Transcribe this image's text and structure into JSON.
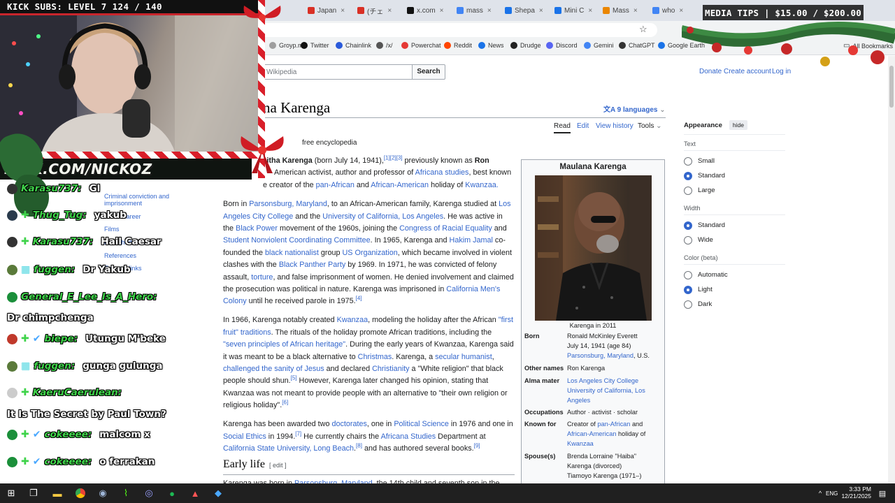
{
  "browser": {
    "tabs": [
      {
        "label": "Japan",
        "color": "#d93025"
      },
      {
        "label": "(チェ",
        "color": "#d93025"
      },
      {
        "label": "x.com",
        "color": "#111111"
      },
      {
        "label": "mass",
        "color": "#4285f4"
      },
      {
        "label": "Shepa",
        "color": "#1a73e8"
      },
      {
        "label": "Mini C",
        "color": "#1a73e8"
      },
      {
        "label": "Mass",
        "color": "#ea8600"
      },
      {
        "label": "who",
        "color": "#4285f4"
      }
    ],
    "bookmarks": [
      {
        "label": "Groyp.me",
        "color": "#9e9e9e"
      },
      {
        "label": "Twitter",
        "color": "#111111"
      },
      {
        "label": "Chainlink",
        "color": "#2a5ada"
      },
      {
        "label": "/x/",
        "color": "#555555"
      },
      {
        "label": "Powerchat",
        "color": "#e53935"
      },
      {
        "label": "Reddit",
        "color": "#ff4500"
      },
      {
        "label": "News",
        "color": "#1a73e8"
      },
      {
        "label": "Drudge",
        "color": "#222222"
      },
      {
        "label": "Discord",
        "color": "#5865f2"
      },
      {
        "label": "Gemini",
        "color": "#4285f4"
      },
      {
        "label": "ChatGPT",
        "color": "#333333"
      },
      {
        "label": "Google Earth",
        "color": "#1a73e8"
      }
    ],
    "all_bookmarks": "All Bookmarks"
  },
  "wiki": {
    "search_placeholder": "Wikipedia",
    "search_button": "Search",
    "top_links": {
      "donate": "Donate",
      "create_account": "Create account",
      "log_in": "Log in"
    },
    "title": "na Karenga",
    "languages": "9 languages",
    "page_tabs": {
      "read": "Read",
      "edit": "Edit",
      "history": "View history",
      "tools": "Tools"
    },
    "tagline": "free encyclopedia",
    "toc": [
      "Criminal conviction and imprisonment",
      "career",
      "Films",
      "Published works",
      "References",
      "External links"
    ],
    "lead": {
      "l1a": "zitha Karenga",
      "l1b": " (born July 14, 1941),",
      "l1sup": "[1][2][3]",
      "l1c": " previously known as ",
      "l1d": "Ron",
      "l2a": "American activist, author and professor of ",
      "l2link": "Africana studies",
      "l2b": ", best known",
      "l3a": "e creator of the ",
      "l3l1": "pan-African",
      "l3b": " and ",
      "l3l2": "African-American",
      "l3c": " holiday of ",
      "l3l3": "Kwanzaa."
    },
    "p2": [
      {
        "t": "Born in "
      },
      {
        "l": "Parsonsburg, Maryland"
      },
      {
        "t": ", to an African-American family, Karenga studied at "
      },
      {
        "l": "Los Angeles City College"
      },
      {
        "t": " and the "
      },
      {
        "l": "University of California, Los Angeles"
      },
      {
        "t": ". He was active in the "
      },
      {
        "l": "Black Power"
      },
      {
        "t": " movement of the 1960s, joining the "
      },
      {
        "l": "Congress of Racial Equality"
      },
      {
        "t": " and "
      },
      {
        "l": "Student Nonviolent Coordinating Committee"
      },
      {
        "t": ". In 1965, Karenga and "
      },
      {
        "l": "Hakim Jamal"
      },
      {
        "t": " co-founded the "
      },
      {
        "l": "black nationalist"
      },
      {
        "t": " group "
      },
      {
        "l": "US Organization"
      },
      {
        "t": ", which became involved in violent clashes with the "
      },
      {
        "l": "Black Panther Party"
      },
      {
        "t": " by 1969. In 1971, he was convicted of felony assault, "
      },
      {
        "l": "torture"
      },
      {
        "t": ", and false imprisonment of women. He denied involvement and claimed the prosecution was political in nature. Karenga was imprisoned in "
      },
      {
        "l": "California Men's Colony"
      },
      {
        "t": " until he received parole in 1975."
      },
      {
        "s": "[4]"
      }
    ],
    "p3": [
      {
        "t": "In 1966, Karenga notably created "
      },
      {
        "l": "Kwanzaa"
      },
      {
        "t": ", modeling the holiday after the African "
      },
      {
        "l": "\"first fruit\" traditions"
      },
      {
        "t": ". The rituals of the holiday promote African traditions, including the "
      },
      {
        "l": "\"seven principles of African heritage\""
      },
      {
        "t": ". During the early years of Kwanzaa, Karenga said it was meant to be a black alternative to "
      },
      {
        "l": "Christmas"
      },
      {
        "t": ". Karenga, a "
      },
      {
        "l": "secular humanist"
      },
      {
        "t": ", "
      },
      {
        "l": "challenged the sanity of Jesus"
      },
      {
        "t": " and declared "
      },
      {
        "l": "Christianity"
      },
      {
        "t": " a \"White religion\" that black people should shun."
      },
      {
        "s": "[5]"
      },
      {
        "t": " However, Karenga later changed his opinion, stating that Kwanzaa was not meant to provide people with an alternative to \"their own religion or religious holiday\"."
      },
      {
        "s": "[6]"
      }
    ],
    "p4": [
      {
        "t": "Karenga has been awarded two "
      },
      {
        "l": "doctorates"
      },
      {
        "t": ", one in "
      },
      {
        "l": "Political Science"
      },
      {
        "t": " in 1976 and one in "
      },
      {
        "l": "Social Ethics"
      },
      {
        "t": " in 1994."
      },
      {
        "s": "[7]"
      },
      {
        "t": " He currently chairs the "
      },
      {
        "l": "Africana Studies"
      },
      {
        "t": " Department at "
      },
      {
        "l": "California State University, Long Beach"
      },
      {
        "t": "."
      },
      {
        "s": "[8]"
      },
      {
        "t": " and has authored several books."
      },
      {
        "s": "[9]"
      }
    ],
    "early_life": "Early life",
    "edit_link": "[ edit ]",
    "last_line_a": "Karenga was born in ",
    "last_line_link": "Parsonsburg, Maryland",
    "last_line_b": ", the 14th child and seventh son in the",
    "infobox": {
      "title": "Maulana Karenga",
      "caption": "Karenga in 2011",
      "born_label": "Born",
      "born_name": "Ronald McKinley Everett",
      "born_date": "July 14, 1941 (age 84)",
      "born_place_link": "Parsonsburg, Maryland",
      "born_place_rest": ", U.S.",
      "other_label": "Other names",
      "other_value": "Ron Karenga",
      "alma_label": "Alma mater",
      "alma_1": "Los Angeles City College",
      "alma_2a": "University of California, Los",
      "alma_2b": "Angeles",
      "occ_label": "Occupations",
      "occ_value": "Author · activist · scholar",
      "known_label": "Known for",
      "known_1a": "Creator of ",
      "known_1link": "pan-African",
      "known_1b": " and",
      "known_2link": "African-American",
      "known_2b": " holiday of",
      "known_3link": "Kwanzaa",
      "spouse_label": "Spouse(s)",
      "spouse_1": "Brenda Lorraine \"Haiba\"",
      "spouse_2": "Karenga (divorced)",
      "spouse_3": "Tiamoyo Karenga (1971–)"
    },
    "appearance": {
      "title": "Appearance",
      "hide": "hide",
      "text_label": "Text",
      "text_options": [
        "Small",
        "Standard",
        "Large"
      ],
      "text_selected": 1,
      "width_label": "Width",
      "width_options": [
        "Standard",
        "Wide"
      ],
      "width_selected": 0,
      "color_label": "Color (beta)",
      "color_options": [
        "Automatic",
        "Light",
        "Dark"
      ],
      "color_selected": 1
    }
  },
  "overlay": {
    "subs": "KICK SUBS: LEVEL 7 124 / 140",
    "media_tips": "MEDIA TIPS | $15.00 / $200.00",
    "kick_url": "KICK.COM/NICKOZ",
    "chat": [
      {
        "user": "Karasu737:",
        "msg": "Gl",
        "avatar": "#333333",
        "badges": ""
      },
      {
        "user": "Thug_Tug:",
        "msg": "yakub",
        "avatar": "#2a3b4c",
        "badges": "✚"
      },
      {
        "user": "Karasu737:",
        "msg": "Hail Caesar",
        "avatar": "#333333",
        "badges": "✚"
      },
      {
        "user": "fuggen:",
        "msg": "Dr Yakub",
        "avatar": "#5a7a3a",
        "badges": "▦"
      },
      {
        "user": "General_E_Lee_Is_A_Hero:",
        "msg": "",
        "avatar": "#1b8f3a",
        "badges": ""
      },
      {
        "user": "biepe:",
        "msg": "Utungu M'beke",
        "avatar": "#c0392b",
        "badges": "✚ ✔"
      },
      {
        "user": "fuggen:",
        "msg": "gunga gulunga",
        "avatar": "#5a7a3a",
        "badges": "▦"
      },
      {
        "user": "KaeruCaerulean:",
        "msg": "",
        "avatar": "#cccccc",
        "badges": "✚"
      },
      {
        "user": "cokeeee:",
        "msg": "malcom x",
        "avatar": "#1b8f3a",
        "badges": "✚ ✔"
      },
      {
        "user": "cokeeee:",
        "msg": "o ferrakan",
        "avatar": "#1b8f3a",
        "badges": "✚ ✔"
      }
    ],
    "chat_cont_1": "Dr chimpchenga",
    "chat_cont_2": "It Is The Secret by Paul Town?"
  },
  "taskbar": {
    "lang": "ENG",
    "time": "3:33 PM",
    "date": "12/21/2025"
  }
}
